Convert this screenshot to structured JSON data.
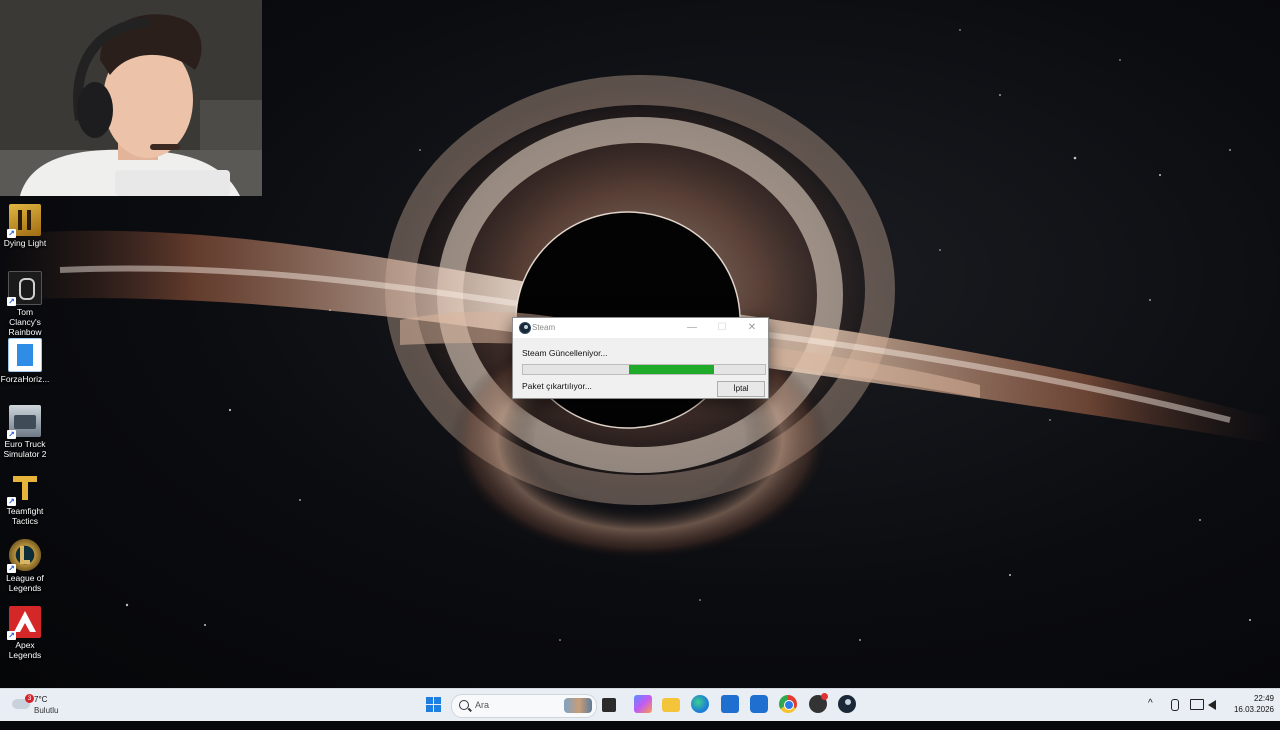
{
  "desktop": {
    "icons": [
      {
        "label": "Dying Light",
        "icon": "dying-light-icon"
      },
      {
        "label": "Tom Clancy's Rainbow Si...",
        "icon": "rainbow-six-icon"
      },
      {
        "label": "ForzaHoriz...",
        "icon": "forza-horizon-icon"
      },
      {
        "label": "Euro Truck Simulator 2",
        "icon": "euro-truck-icon"
      },
      {
        "label": "Teamfight Tactics",
        "icon": "teamfight-tactics-icon"
      },
      {
        "label": "League of Legends",
        "icon": "league-of-legends-icon"
      },
      {
        "label": "Apex Legends",
        "icon": "apex-legends-icon"
      }
    ]
  },
  "dialog": {
    "title": "Steam",
    "status": "Steam Güncelleniyor...",
    "progress": {
      "start_fraction": 0.44,
      "end_fraction": 0.79,
      "color": "#1faa2a"
    },
    "detail": "Paket çıkartılıyor...",
    "cancel_label": "İptal",
    "minimize_glyph": "—",
    "maximize_glyph": "☐",
    "close_glyph": "✕"
  },
  "taskbar": {
    "weather": {
      "temp": "7°C",
      "condition": "Bulutlu",
      "badge": "3"
    },
    "search_placeholder": "Ara",
    "apps": [
      "task-view-icon",
      "copilot-icon",
      "file-explorer-icon",
      "edge-icon",
      "store-icon",
      "outlook-icon",
      "chrome-icon",
      "app-with-badge-icon",
      "steam-icon"
    ],
    "tray": {
      "chevron": "^",
      "time": "22:49",
      "date": "16.03.2026"
    }
  }
}
